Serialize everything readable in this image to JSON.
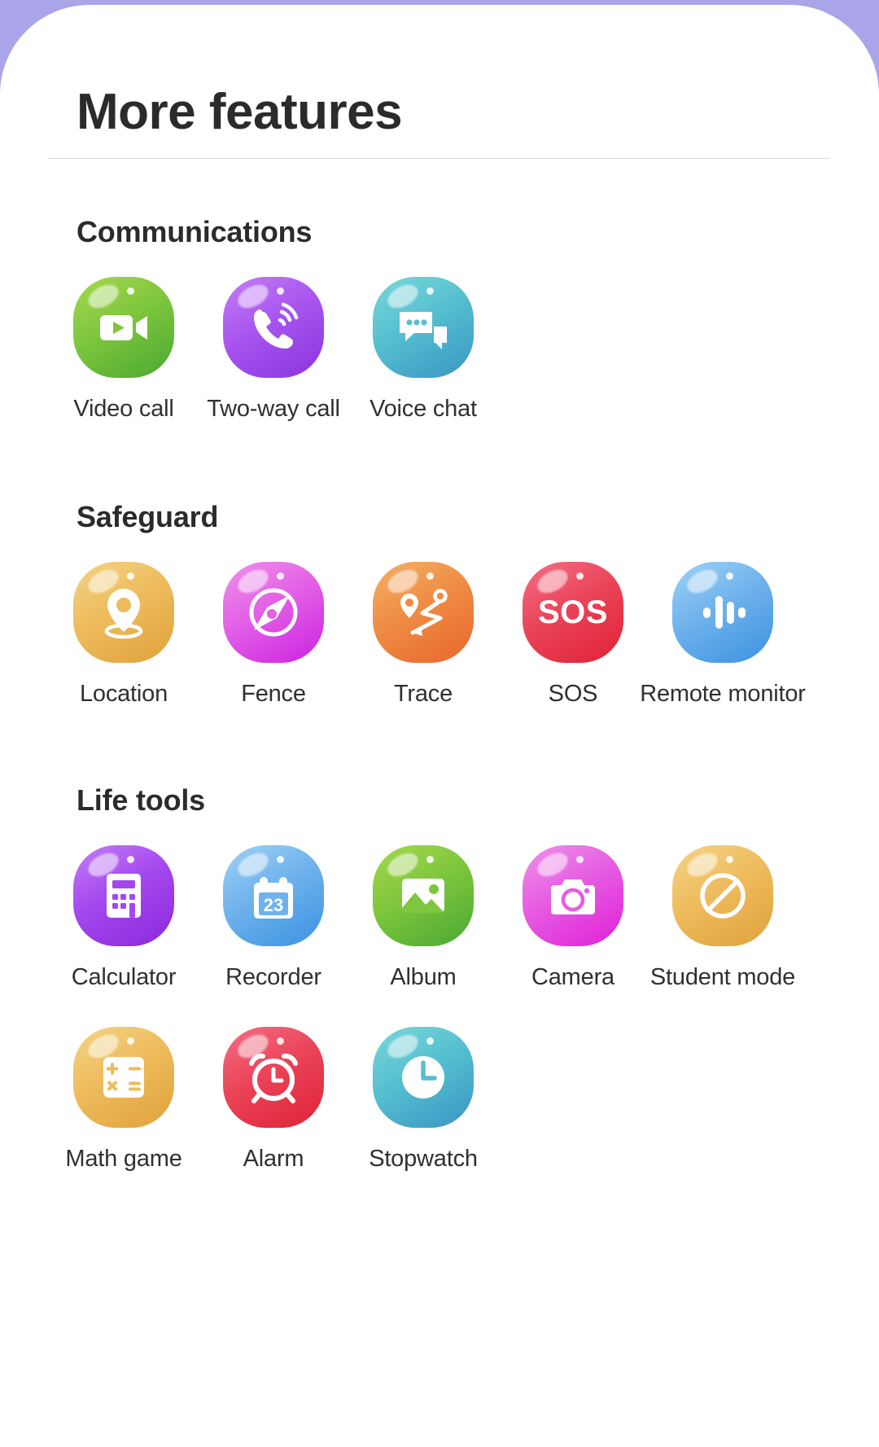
{
  "page": {
    "title": "More features",
    "background_color": "#a9a5e8",
    "card_color": "#ffffff"
  },
  "sections": [
    {
      "id": "communications",
      "title": "Communications",
      "apps": [
        {
          "label": "Video call",
          "icon": "video-camera-icon",
          "color_from": "#a6d84f",
          "color_to": "#4aa832"
        },
        {
          "label": "Two-way call",
          "icon": "phone-call-icon",
          "color_from": "#b96ef0",
          "color_to": "#8b33e0"
        },
        {
          "label": "Voice chat",
          "icon": "chat-bubbles-icon",
          "color_from": "#66cfd2",
          "color_to": "#3b95c4"
        }
      ]
    },
    {
      "id": "safeguard",
      "title": "Safeguard",
      "apps": [
        {
          "label": "Location",
          "icon": "map-pin-icon",
          "color_from": "#f0cf78",
          "color_to": "#e0a23c"
        },
        {
          "label": "Fence",
          "icon": "compass-icon",
          "color_from": "#e97ce0",
          "color_to": "#cc22e0"
        },
        {
          "label": "Trace",
          "icon": "route-trace-icon",
          "color_from": "#f0a24a",
          "color_to": "#e8662e"
        },
        {
          "label": "SOS",
          "icon": "sos-text-icon",
          "color_from": "#ef5a74",
          "color_to": "#e02235"
        },
        {
          "label": "Remote monitor",
          "icon": "waveform-icon",
          "color_from": "#8cc8f2",
          "color_to": "#3b92e0"
        }
      ]
    },
    {
      "id": "life-tools",
      "title": "Life tools",
      "apps": [
        {
          "label": "Calculator",
          "icon": "calculator-icon",
          "color_from": "#bb6ef0",
          "color_to": "#8b28dc"
        },
        {
          "label": "Recorder",
          "icon": "calendar-23-icon",
          "color_from": "#8cc8f2",
          "color_to": "#3b92e0",
          "badge": "23"
        },
        {
          "label": "Album",
          "icon": "photo-image-icon",
          "color_from": "#a6d84f",
          "color_to": "#4aa832"
        },
        {
          "label": "Camera",
          "icon": "camera-icon",
          "color_from": "#e97ce0",
          "color_to": "#e020d8"
        },
        {
          "label": "Student mode",
          "icon": "prohibition-icon",
          "color_from": "#f0cf78",
          "color_to": "#e0a23c"
        },
        {
          "label": "Math game",
          "icon": "math-keypad-icon",
          "color_from": "#f0cf78",
          "color_to": "#e0a23c"
        },
        {
          "label": "Alarm",
          "icon": "alarm-clock-icon",
          "color_from": "#ef5a74",
          "color_to": "#e02235"
        },
        {
          "label": "Stopwatch",
          "icon": "clock-icon",
          "color_from": "#66cfd2",
          "color_to": "#3b95c4"
        }
      ]
    }
  ]
}
